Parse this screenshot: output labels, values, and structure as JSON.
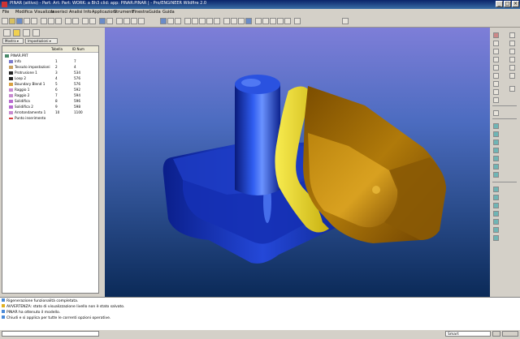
{
  "window": {
    "title": "PINAR (attivo) - Part: Art: Part: WORK: a Bh3 clid: app: PINAR:PINAR | - Pro/ENGINEER Wildfire 2.0",
    "controls": {
      "minimize": "_",
      "maximize": "□",
      "close": "×"
    }
  },
  "menu": [
    "File",
    "Modifica",
    "Visualizza",
    "Inserisci",
    "Analisi",
    "Info",
    "Applicazioni",
    "Strumenti",
    "Finestra",
    "Guida",
    "Guida"
  ],
  "sidebar": {
    "filters": [
      "Mostra ▾",
      "Impostazioni ▾"
    ],
    "columns": {
      "name": "",
      "type": "Tabella",
      "id": "ID Num"
    },
    "rows": [
      {
        "name": "PINAR.PRT",
        "type": "",
        "id": "",
        "icon": "part"
      },
      {
        "name": "Info",
        "type": "1",
        "id": "7",
        "icon": "info"
      },
      {
        "name": "Tessuto impostazioni",
        "type": "2",
        "id": "4",
        "icon": "datum"
      },
      {
        "name": "Protrusione 1",
        "type": "3",
        "id": "534",
        "icon": "feature"
      },
      {
        "name": "Loop 2",
        "type": "4",
        "id": "576",
        "icon": "feature"
      },
      {
        "name": "Boundary Blend 1",
        "type": "5",
        "id": "576",
        "icon": "blend"
      },
      {
        "name": "Raggio 1",
        "type": "6",
        "id": "592",
        "icon": "round"
      },
      {
        "name": "Raggio 2",
        "type": "7",
        "id": "594",
        "icon": "round"
      },
      {
        "name": "Solidifica",
        "type": "8",
        "id": "596",
        "icon": "solid"
      },
      {
        "name": "Solidifica 2",
        "type": "9",
        "id": "598",
        "icon": "solid"
      },
      {
        "name": "Arrotondamento 1",
        "type": "10",
        "id": "1100",
        "icon": "round"
      },
      {
        "name": "Punto inserimento",
        "type": "",
        "id": "",
        "icon": "insert"
      }
    ]
  },
  "messages": [
    {
      "text": "Rigenerazione funzionalità completata.",
      "icon": "info"
    },
    {
      "text": "AVVERTENZA: stato di visualizzazione livello non è stato salvato.",
      "icon": "warn"
    },
    {
      "text": "PINAR ha ottenuto il modello.",
      "icon": "info"
    },
    {
      "text": "Chiudi e si applica per tutte le correnti opzioni operative.",
      "icon": "info"
    }
  ],
  "status": {
    "filter": "Smart",
    "left": ""
  },
  "colors": {
    "viewport_top": "#7e7ed8",
    "viewport_bottom": "#0b2a58",
    "base_blue": "#1e40c8",
    "gold": "#b07a0a",
    "yellow": "#f2e030"
  }
}
